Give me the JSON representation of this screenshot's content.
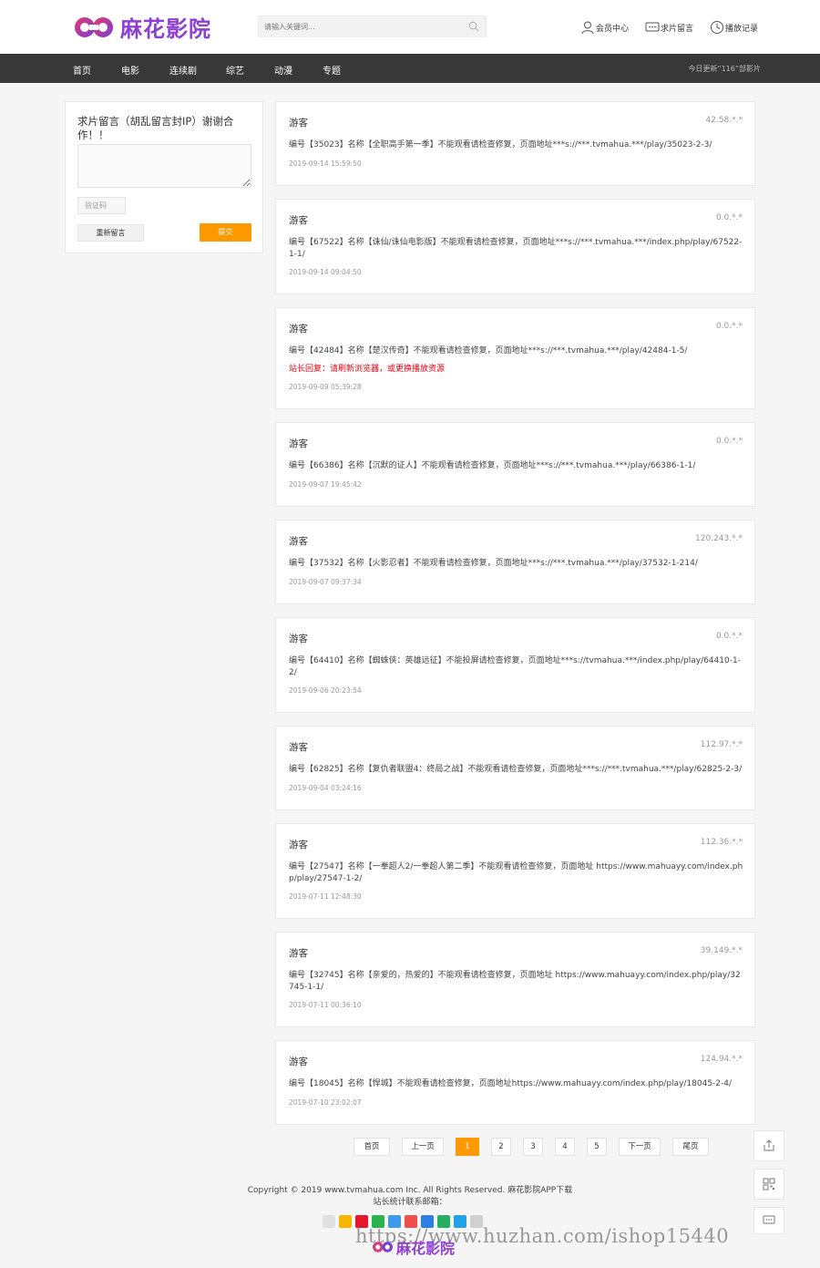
{
  "header": {
    "site_name": "麻花影院",
    "search_placeholder": "请输入关键词...",
    "links": [
      {
        "label": "会员中心",
        "icon": "user-icon"
      },
      {
        "label": "求片留言",
        "icon": "message-icon"
      },
      {
        "label": "播放记录",
        "icon": "clock-icon"
      }
    ]
  },
  "nav": {
    "items": [
      "首页",
      "电影",
      "连续剧",
      "综艺",
      "动漫",
      "专题"
    ],
    "update_note": "今日更新“116”部影片"
  },
  "side": {
    "title": "求片留言（胡乱留言封IP）谢谢合作！！",
    "captcha_placeholder": "验证码",
    "reset_label": "重新留言",
    "submit_label": "提交"
  },
  "messages": [
    {
      "user": "游客",
      "ip": "42.58.*.*",
      "body": "编号【35023】名称【全职高手第一季】不能观看请检查修复，页面地址***s://***.tvmahua.***/play/35023-2-3/",
      "reply": "",
      "time": "2019-09-14 15:59:50"
    },
    {
      "user": "游客",
      "ip": "0.0.*.*",
      "body": "编号【67522】名称【诛仙/诛仙电影版】不能观看请检查修复，页面地址***s://***.tvmahua.***/index.php/play/67522-1-1/",
      "reply": "",
      "time": "2019-09-14 09:04:50"
    },
    {
      "user": "游客",
      "ip": "0.0.*.*",
      "body": "编号【42484】名称【楚汉传奇】不能观看请检查修复，页面地址***s://***.tvmahua.***/play/42484-1-5/",
      "reply": "站长回复：请刷新浏览器，或更换播放资源",
      "time": "2019-09-09 05:39:28"
    },
    {
      "user": "游客",
      "ip": "0.0.*.*",
      "body": "编号【66386】名称【沉默的证人】不能观看请检查修复，页面地址***s://***.tvmahua.***/play/66386-1-1/",
      "reply": "",
      "time": "2019-09-07 19:45:42"
    },
    {
      "user": "游客",
      "ip": "120.243.*.*",
      "body": "编号【37532】名称【火影忍者】不能观看请检查修复，页面地址***s://***.tvmahua.***/play/37532-1-214/",
      "reply": "",
      "time": "2019-09-07 09:37:34"
    },
    {
      "user": "游客",
      "ip": "0.0.*.*",
      "body": "编号【64410】名称【蜘蛛侠：英雄远征】不能投屏请检查修复，页面地址***s://tvmahua.***/index.php/play/64410-1-2/",
      "reply": "",
      "time": "2019-09-06 20:23:54"
    },
    {
      "user": "游客",
      "ip": "112.97.*.*",
      "body": "编号【62825】名称【复仇者联盟4：终局之战】不能观看请检查修复，页面地址***s://***.tvmahua.***/play/62825-2-3/",
      "reply": "",
      "time": "2019-09-04 03:24:16"
    },
    {
      "user": "游客",
      "ip": "112.36.*.*",
      "body": "编号【27547】名称【一拳超人2/一拳超人第二季】不能观看请检查修复，页面地址 https://www.mahuayy.com/index.php/play/27547-1-2/",
      "reply": "",
      "time": "2019-07-11 12:48:30"
    },
    {
      "user": "游客",
      "ip": "39.149.*.*",
      "body": "编号【32745】名称【亲爱的，热爱的】不能观看请检查修复，页面地址 https://www.mahuayy.com/index.php/play/32745-1-1/",
      "reply": "",
      "time": "2019-07-11 00:36:10"
    },
    {
      "user": "游客",
      "ip": "124.94.*.*",
      "body": "编号【18045】名称【悍城】不能观看请检查修复，页面地址https://www.mahuayy.com/index.php/play/18045-2-4/",
      "reply": "",
      "time": "2019-07-10 23:02:07"
    }
  ],
  "pager": [
    "首页",
    "上一页",
    "1",
    "2",
    "3",
    "4",
    "5",
    "下一页",
    "尾页"
  ],
  "pager_active": "1",
  "footer": {
    "copyright": "Copyright © 2019 www.tvmahua.com Inc. All Rights Reserved. 麻花影院APP下载",
    "contact": "站长统计联系邮箱：",
    "watermark": "https://www.huzhan.com/ishop15440",
    "watermark_logo": "麻花影院"
  },
  "colors": {
    "accent": "#ff9900",
    "nav_bg": "#383838",
    "brand": "#8e3fd1",
    "reply": "#e60012"
  }
}
